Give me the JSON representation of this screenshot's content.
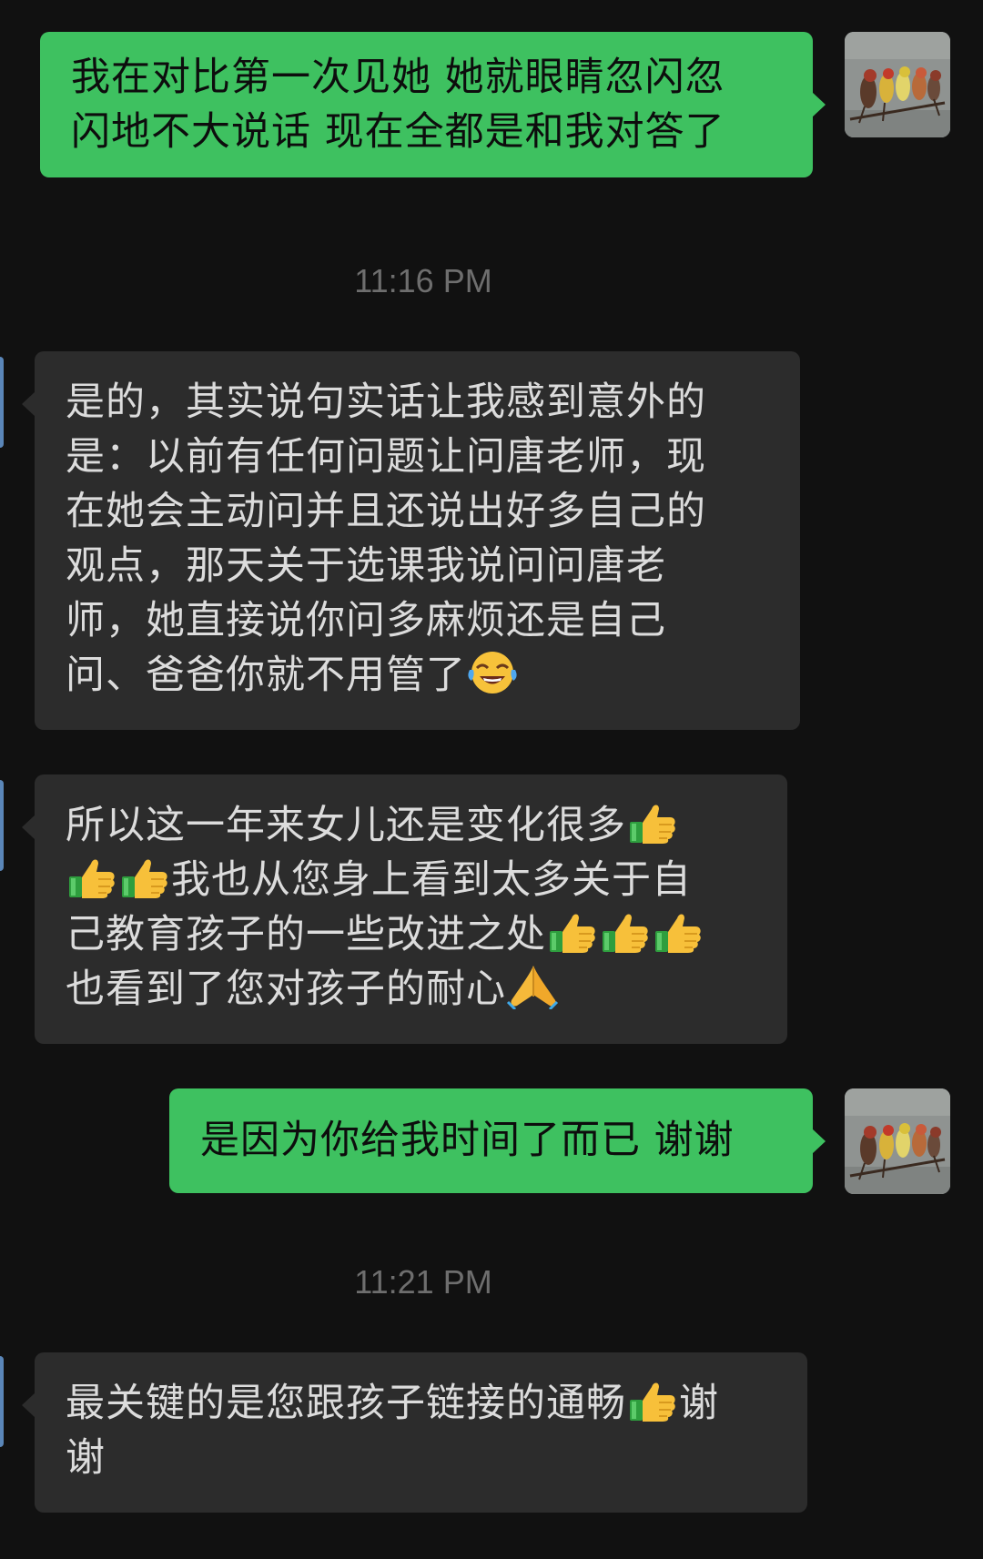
{
  "messages": [
    {
      "direction": "outgoing",
      "lines": [
        "我在对比第一次见她 她就眼睛忽闪忽",
        "闪地不大说话 现在全都是和我对答了"
      ]
    },
    {
      "timestamp": "11:16 PM"
    },
    {
      "direction": "incoming",
      "lines": [
        "是的，其实说句实话让我感到意外的",
        "是：以前有任何问题让问唐老师，现",
        "在她会主动问并且还说出好多自己的",
        "观点，那天关于选课我说问问唐老",
        "师，她直接说你问多麻烦还是自己",
        "问、爸爸你就不用管了"
      ],
      "trailing_emoji": "face-with-tears-of-joy"
    },
    {
      "direction": "incoming",
      "segments": [
        "所以这一年来女儿还是变化很多",
        "我也从您身上看到太多关于自",
        "己教育孩子的一些改进之处",
        "也看到了您对孩子的耐心"
      ],
      "emojis": [
        "thumbs-up",
        "folded-hands"
      ]
    },
    {
      "direction": "outgoing",
      "lines": [
        "是因为你给我时间了而已 谢谢"
      ]
    },
    {
      "timestamp": "11:21 PM"
    },
    {
      "direction": "incoming",
      "segments": [
        "最关键的是您跟孩子链接的通畅",
        "谢",
        "谢"
      ],
      "emojis": [
        "thumbs-up"
      ]
    }
  ],
  "colors": {
    "background": "#111111",
    "outgoing_bubble": "#3EC160",
    "incoming_bubble": "#2C2C2C",
    "incoming_text": "#DCDCDC",
    "timestamp_text": "#6E6E6E"
  },
  "avatar": {
    "icon": "birds-on-branch-avatar"
  }
}
